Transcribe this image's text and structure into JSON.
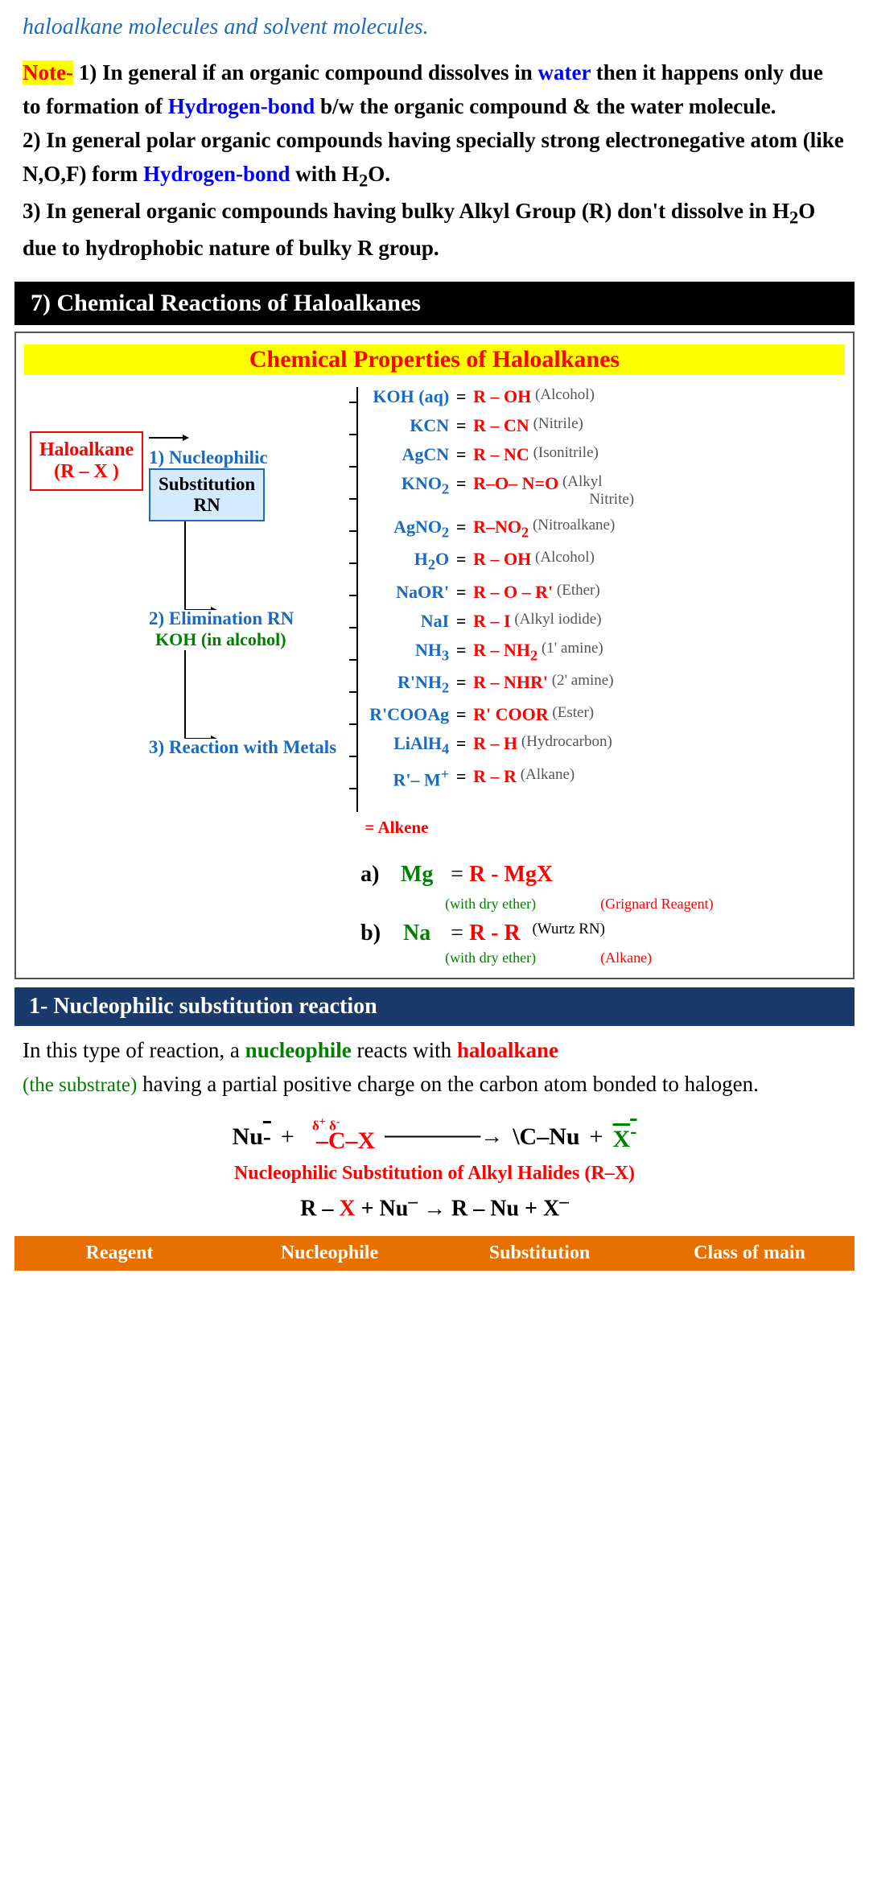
{
  "top_text": "haloalkane molecules and solvent molecules.",
  "note": {
    "label": "Note-",
    "point1_pre": "1)  In general if an organic compound dissolves in ",
    "point1_water": "water",
    "point1_mid": " then it happens only due to formation of ",
    "point1_hbond": "Hydrogen-bond",
    "point1_post": " b/w the organic compound & the water molecule.",
    "point2_pre": "2)  In general polar organic compounds having specially strong electronegative atom (like N,O,F) form ",
    "point2_hbond": "Hydrogen-bond",
    "point2_post_pre": " with H",
    "point2_post_sub": "2",
    "point2_post_suf": "O.",
    "point3_pre": "3)  In general organic compounds having bulky Alkyl Group (R) don't dissolve in H",
    "point3_sub": "2",
    "point3_post": "O due to hydrophobic nature of bulky R group."
  },
  "section7": {
    "label": "7) Chemical Reactions of Haloalkanes"
  },
  "diagram": {
    "title": "Chemical Properties of Haloalkanes",
    "haloalkane": "Haloalkane\n(R – X )",
    "nucleophilic_title": "1) Nucleophilic",
    "sub_box": "Substitution\nRN",
    "reagents": [
      {
        "reagent": "KOH (aq)",
        "eq": "=",
        "product": "R – OH",
        "note": "(Alcohol)"
      },
      {
        "reagent": "KCN",
        "eq": "=",
        "product": "R – CN",
        "note": "(Nitrile)"
      },
      {
        "reagent": "AgCN",
        "eq": "=",
        "product": "R – NC",
        "note": "(Isonitrile)"
      },
      {
        "reagent": "KNO₂",
        "eq": "=",
        "product": "R–O– N=O",
        "note": "(Alkyl Nitrite)"
      },
      {
        "reagent": "AgNO₂",
        "eq": "=",
        "product": "R–NO₂",
        "note": "(Nitroalkane)"
      },
      {
        "reagent": "H₂O",
        "eq": "=",
        "product": "R – OH",
        "note": "(Alcohol)"
      },
      {
        "reagent": "NaOR'",
        "eq": "=",
        "product": "R – O – R'",
        "note": "(Ether)"
      },
      {
        "reagent": "NaI",
        "eq": "=",
        "product": "R – I",
        "note": "(Alkyl iodide)"
      },
      {
        "reagent": "NH₃",
        "eq": "=",
        "product": "R – NH₂",
        "note": "(1' amine)"
      },
      {
        "reagent": "R'NH₂",
        "eq": "=",
        "product": "R – NHR'",
        "note": "(2' amine)"
      },
      {
        "reagent": "R'COOAg",
        "eq": "=",
        "product": "R' COOR",
        "note": "(Ester)"
      },
      {
        "reagent": "LiAlH₄",
        "eq": "=",
        "product": "R – H",
        "note": "(Hydrocarbon)"
      },
      {
        "reagent": "R'– M⁺",
        "eq": "=",
        "product": "R – R",
        "note": "(Alkane)"
      }
    ],
    "elimination_title": "2) Elimination RN",
    "elimination_reagent": "KOH (in alcohol)",
    "elimination_product": "= Alkene",
    "metals_title": "3) Reaction with Metals",
    "metals": [
      {
        "label": "a)",
        "reagent": "Mg",
        "eq": "=",
        "product": "R - MgX",
        "note1": "(with dry ether)",
        "note2": "(Grignard Reagent)"
      },
      {
        "label": "b)",
        "reagent": "Na",
        "eq": "=",
        "product": "R - R",
        "product_note": "(Wurtz RN)",
        "note1": "(with dry ether)",
        "note2": "(Alkane)"
      }
    ]
  },
  "sub_section": {
    "label": "1- Nucleophilic substitution reaction"
  },
  "body_text": {
    "part1": "In this type of reaction, a ",
    "nucleophile": "nucleophile",
    "part2": " reacts with ",
    "haloalkane": "haloalkane",
    "substrate": "(the substrate)",
    "part3": " having a partial positive charge on the carbon atom bonded to halogen."
  },
  "rxn_equation": {
    "left": "Nu⁻  +",
    "middle": "δ⁺ δ⁻\n–C–X",
    "arrow": "→",
    "right": "–C–Nu  +",
    "product": "X̄⁻"
  },
  "rxn_formula_title": "Nucleophilic Substitution of Alkyl Halides (R–X)",
  "rxn_formula_eq": "R – X + Nu⁻ → R – Nu + X⁻",
  "table_header": {
    "col1": "Reagent",
    "col2": "Nucleophile",
    "col3": "Substitution",
    "col4": "Class of main"
  },
  "colors": {
    "blue": "#1a6bbf",
    "red": "#cc0000",
    "green": "#008000",
    "yellow": "#ffd700",
    "orange": "#e87000",
    "dark_blue_header": "#1a3a6b",
    "black": "#000"
  }
}
